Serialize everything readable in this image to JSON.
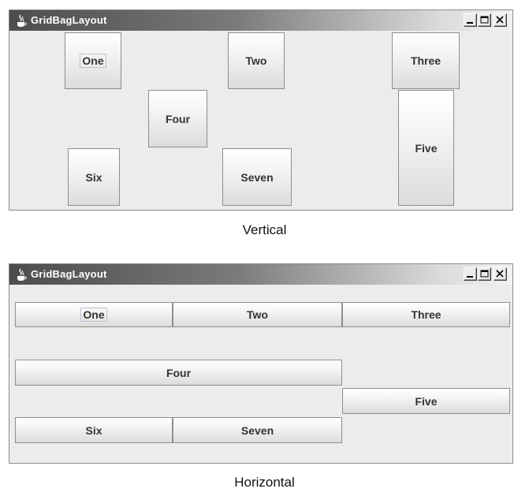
{
  "vertical": {
    "window_title": "GridBagLayout",
    "buttons": {
      "one": "One",
      "two": "Two",
      "three": "Three",
      "four": "Four",
      "five": "Five",
      "six": "Six",
      "seven": "Seven"
    },
    "caption": "Vertical"
  },
  "horizontal": {
    "window_title": "GridBagLayout",
    "buttons": {
      "one": "One",
      "two": "Two",
      "three": "Three",
      "four": "Four",
      "five": "Five",
      "six": "Six",
      "seven": "Seven"
    },
    "caption": "Horizontal"
  },
  "window_controls": {
    "minimize_icon": "minimize-icon",
    "maximize_icon": "maximize-icon",
    "close_icon": "close-icon"
  },
  "focused_button": "One"
}
